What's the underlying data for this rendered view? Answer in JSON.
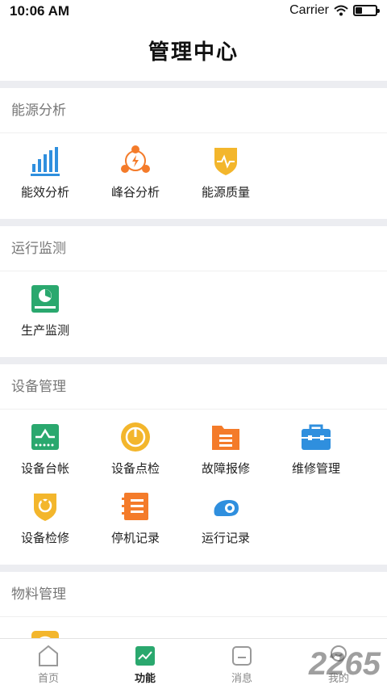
{
  "status_bar": {
    "time": "10:06 AM",
    "carrier": "Carrier",
    "battery_level": 0.35
  },
  "nav": {
    "title": "管理中心"
  },
  "sections": [
    {
      "title": "能源分析",
      "items": [
        {
          "label": "能效分析",
          "icon": "bar-chart-icon"
        },
        {
          "label": "峰谷分析",
          "icon": "peak-valley-icon"
        },
        {
          "label": "能源质量",
          "icon": "shield-pulse-icon"
        }
      ]
    },
    {
      "title": "运行监测",
      "items": [
        {
          "label": "生产监测",
          "icon": "monitor-pie-icon"
        }
      ]
    },
    {
      "title": "设备管理",
      "items": [
        {
          "label": "设备台帐",
          "icon": "device-ledger-icon"
        },
        {
          "label": "设备点检",
          "icon": "device-inspect-icon"
        },
        {
          "label": "故障报修",
          "icon": "folder-list-icon"
        },
        {
          "label": "维修管理",
          "icon": "toolbox-icon"
        },
        {
          "label": "设备检修",
          "icon": "shield-wrench-icon"
        },
        {
          "label": "停机记录",
          "icon": "notebook-icon"
        },
        {
          "label": "运行记录",
          "icon": "run-record-icon"
        }
      ]
    },
    {
      "title": "物料管理",
      "items": [
        {
          "label": "",
          "icon": "material-icon"
        }
      ]
    }
  ],
  "tabs": [
    {
      "label": "首页",
      "icon": "home-icon",
      "active": false
    },
    {
      "label": "功能",
      "icon": "function-chart-icon",
      "active": true
    },
    {
      "label": "消息",
      "icon": "message-icon",
      "active": false
    },
    {
      "label": "我的",
      "icon": "profile-icon",
      "active": false
    }
  ],
  "watermark": "2265",
  "colors": {
    "blue": "#2f8fde",
    "orange": "#f47b2a",
    "yellow": "#f3b62c",
    "green": "#2aa86e",
    "divider": "#ecedf1"
  }
}
